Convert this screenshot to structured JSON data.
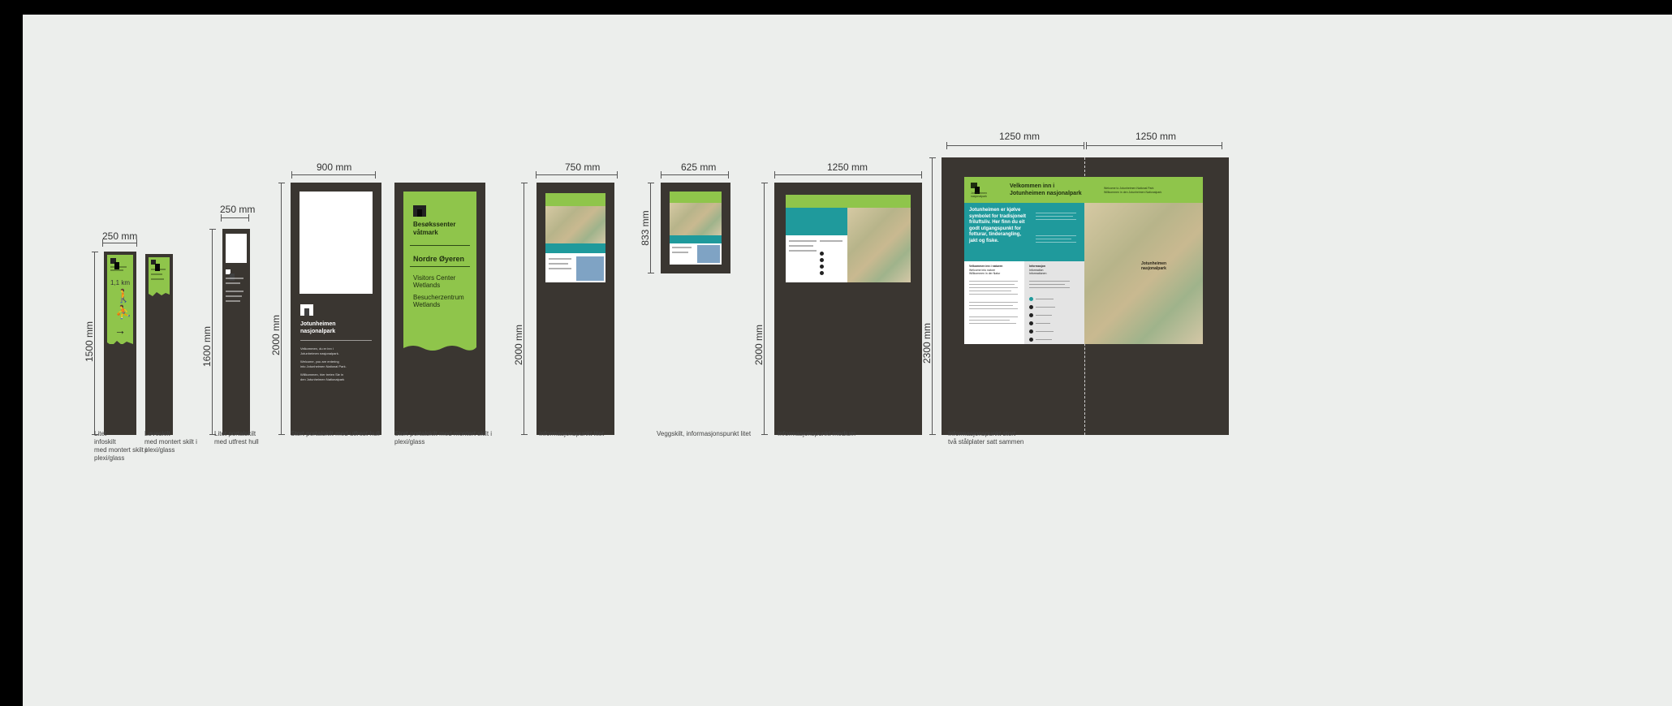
{
  "dims": {
    "small_250": "250 mm",
    "portal_small_250": "250 mm",
    "portal_large_900": "900 mm",
    "info_small_750": "750 mm",
    "wall_625": "625 mm",
    "info_medium_1250": "1250 mm",
    "info_large_left": "1250 mm",
    "info_large_right": "1250 mm",
    "h_1500": "1500 mm",
    "h_1600": "1600 mm",
    "h_2000_portal": "2000 mm",
    "h_2000_info": "2000 mm",
    "h_833": "833 mm",
    "h_2000_medium": "2000 mm",
    "h_2300": "2300 mm"
  },
  "captions": {
    "c1": [
      "Litet",
      "infoskilt",
      "med montert skilt i",
      "plexi/glass"
    ],
    "c2": [
      "Løveskilt",
      "med montert skilt i",
      "plexi/glass"
    ],
    "c3": [
      "Litet portalskilt",
      "med utfrest hull"
    ],
    "c4": [
      "Stort portalskilt med utfrest hull"
    ],
    "c5": [
      "Stort portalskilt med montert skilt i",
      "plexi/glass"
    ],
    "c6": [
      "Informasjonspunkt litet"
    ],
    "c7": [
      "Veggskilt, informasjonspunkt litet"
    ],
    "c8": [
      "Informasjonspunkt medium"
    ],
    "c9": [
      "Informasjonspunkt stort",
      "två stålplater satt sammen"
    ]
  },
  "sign1": {
    "distance": "1,1 km"
  },
  "portal_large": {
    "park_name": [
      "Jotunheimen",
      "nasjonalpark"
    ],
    "welcome_no": [
      "Velkommen, du er inn i",
      "Jotunheimen nasjonalpark."
    ],
    "welcome_en": [
      "Welcome, you are entering",
      "into Jotunheimen National Park."
    ],
    "welcome_de": [
      "Willkommen, hier treten Sie in",
      "den Jotunheimen Nationalpark"
    ]
  },
  "portal_glass": {
    "title": [
      "Besøkssenter",
      "våtmark"
    ],
    "place": "Nordre Øyeren",
    "en": [
      "Visitors Center",
      "Wetlands"
    ],
    "de": [
      "Besucherzentrum",
      "Wetlands"
    ]
  },
  "large_board": {
    "header_title": [
      "Velkommen inn i",
      "Jotunheimen nasjonalpark"
    ],
    "header_sub": [
      "Welcome to Jotunheimen National Park",
      "Willkommen in den Jotunheimen Nationalpark"
    ],
    "logo_text": [
      "Jotunheimen",
      "nasjonalpark"
    ],
    "lead": [
      "Jotunheimen er kjølve",
      "symbolet for tradisjonelt",
      "friluftsliv. Her finn du eit",
      "godt utgangspunkt for",
      "fotturar, tinderangling,",
      "jakt og fiske."
    ],
    "section_left": [
      "Velkommen inn i naturen",
      "Welcome into nature",
      "Willkommen in der Natur"
    ],
    "section_right": [
      "Informasjon",
      "Information",
      "Informationen"
    ],
    "map_label": [
      "Jotunheimen",
      "nasjonalpark"
    ]
  },
  "colors": {
    "brown": "#3a3631",
    "green": "#8fc54b",
    "teal": "#1f9a9c",
    "background": "#eceeec"
  }
}
